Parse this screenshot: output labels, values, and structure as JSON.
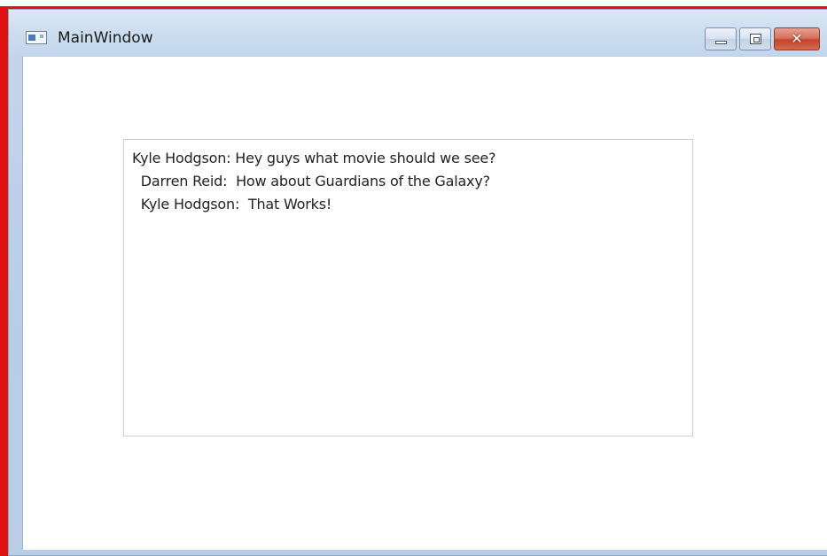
{
  "window": {
    "title": "MainWindow",
    "buttons": {
      "minimize": "",
      "maximize": "",
      "close": "✕"
    }
  },
  "chat": {
    "lines": [
      "Kyle Hodgson: Hey guys what movie should we see?",
      "  Darren Reid:  How about Guardians of the Galaxy?",
      "  Kyle Hodgson:  That Works!"
    ]
  },
  "colors": {
    "frame_accent": "#e01212",
    "window_chrome": "#c3d6ec",
    "close_button": "#c5432a"
  }
}
